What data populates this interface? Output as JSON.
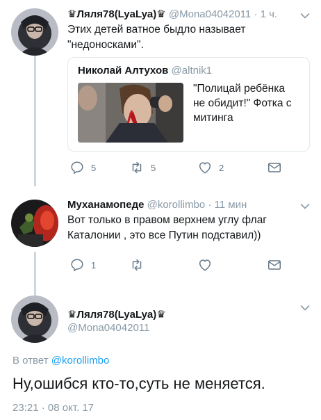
{
  "tweet1": {
    "display_name": "♛Ляля78(LyaLya)♛",
    "handle": "@Mona04042011",
    "time": "1 ч.",
    "text_line1": "Этих детей ватное быдло называет",
    "text_line2": "\"недоносками\".",
    "quote": {
      "display_name": "Николай Алтухов",
      "handle": "@altnik1",
      "text_line1": "\"Полицай ребёнка",
      "text_line2": "не обидит!\"  Фотка с",
      "text_line3": "митинга"
    },
    "actions": {
      "reply_count": "5",
      "retweet_count": "5",
      "like_count": "2"
    }
  },
  "tweet2": {
    "display_name": "Муханамопеде",
    "handle": "@korollimbo",
    "time": "11 мин",
    "text_line1": "Вот только в правом верхнем углу флаг",
    "text_line2": "Каталонии , это все Путин подставил))",
    "actions": {
      "reply_count": "1"
    }
  },
  "main_tweet": {
    "display_name": "♛Ляля78(LyaLya)♛",
    "handle": "@Mona04042011",
    "reply_prefix": "В ответ",
    "reply_handle": "@korollimbo",
    "text": "Ну,ошибся кто-то,суть не меняется.",
    "timestamp": "23:21 · 08 окт. 17"
  },
  "icons": {
    "reply": "reply-icon",
    "retweet": "retweet-icon",
    "like": "heart-icon",
    "dm": "envelope-icon",
    "more": "chevron-down-icon"
  },
  "colors": {
    "text": "#14171a",
    "secondary": "#8899a6",
    "icon": "#657786",
    "link": "#1da1f2",
    "thread_line": "#ccd6dd",
    "border": "#e1e8ed"
  }
}
